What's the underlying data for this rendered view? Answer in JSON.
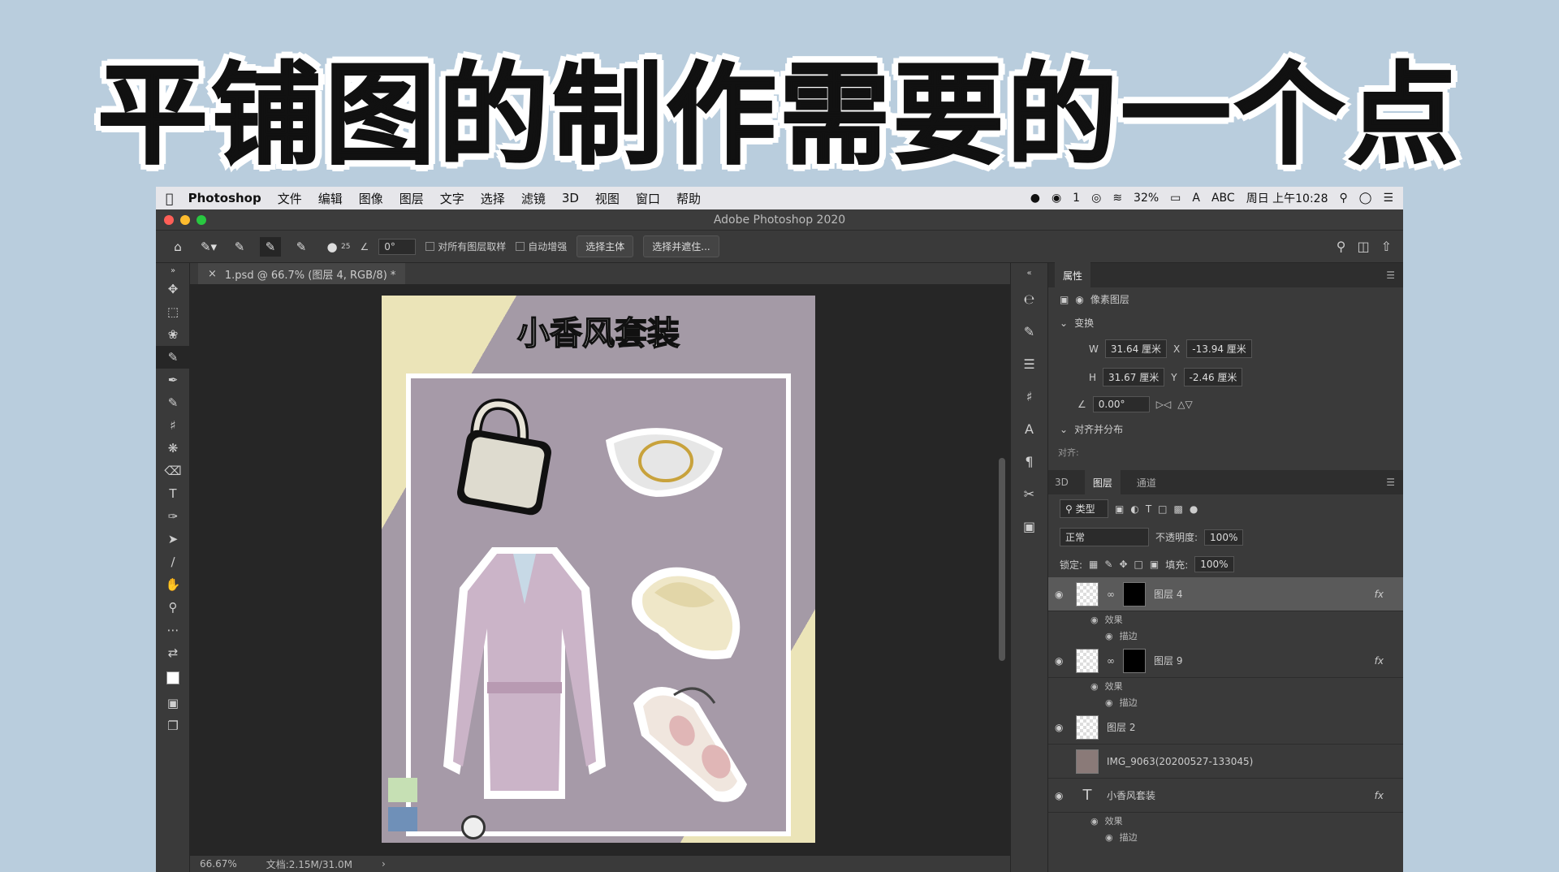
{
  "banner": {
    "title": "平铺图的制作需要的一个点"
  },
  "menubar": {
    "app": "Photoshop",
    "items": [
      "文件",
      "编辑",
      "图像",
      "图层",
      "文字",
      "选择",
      "滤镜",
      "3D",
      "视图",
      "窗口",
      "帮助"
    ],
    "status": {
      "wechat_count": "1",
      "battery": "32%",
      "input": "ABC",
      "clock": "周日 上午10:28"
    }
  },
  "window": {
    "title": "Adobe Photoshop 2020"
  },
  "options": {
    "brush_size": "25",
    "angle": "0°",
    "sample_all_layers": "对所有图层取样",
    "auto_enhance": "自动增强",
    "select_subject": "选择主体",
    "select_mask": "选择并遮住..."
  },
  "document": {
    "tab_label": "1.psd @ 66.7% (图层 4, RGB/8) *",
    "canvas_title": "小香风套装",
    "zoom": "66.67%",
    "doc_size": "文档:2.15M/31.0M"
  },
  "properties": {
    "tab": "属性",
    "kind": "像素图层",
    "transform_label": "变换",
    "w": "31.64 厘米",
    "x": "-13.94 厘米",
    "h": "31.67 厘米",
    "y": "-2.46 厘米",
    "angle": "0.00°",
    "align_label": "对齐并分布",
    "align_sub": "对齐:"
  },
  "layers_panel": {
    "tabs": [
      "3D",
      "图层",
      "通道"
    ],
    "filter": "类型",
    "blend_mode": "正常",
    "opacity_label": "不透明度:",
    "opacity": "100%",
    "lock_label": "锁定:",
    "fill_label": "填充:",
    "fill": "100%",
    "effects_label": "效果",
    "stroke_label": "描边",
    "layers": [
      {
        "name": "图层 4",
        "fx": "fx"
      },
      {
        "name": "图层 9",
        "fx": "fx"
      },
      {
        "name": "图层 2"
      },
      {
        "name": "IMG_9063(20200527-133045)"
      },
      {
        "name": "小香风套装",
        "fx": "fx"
      }
    ]
  }
}
